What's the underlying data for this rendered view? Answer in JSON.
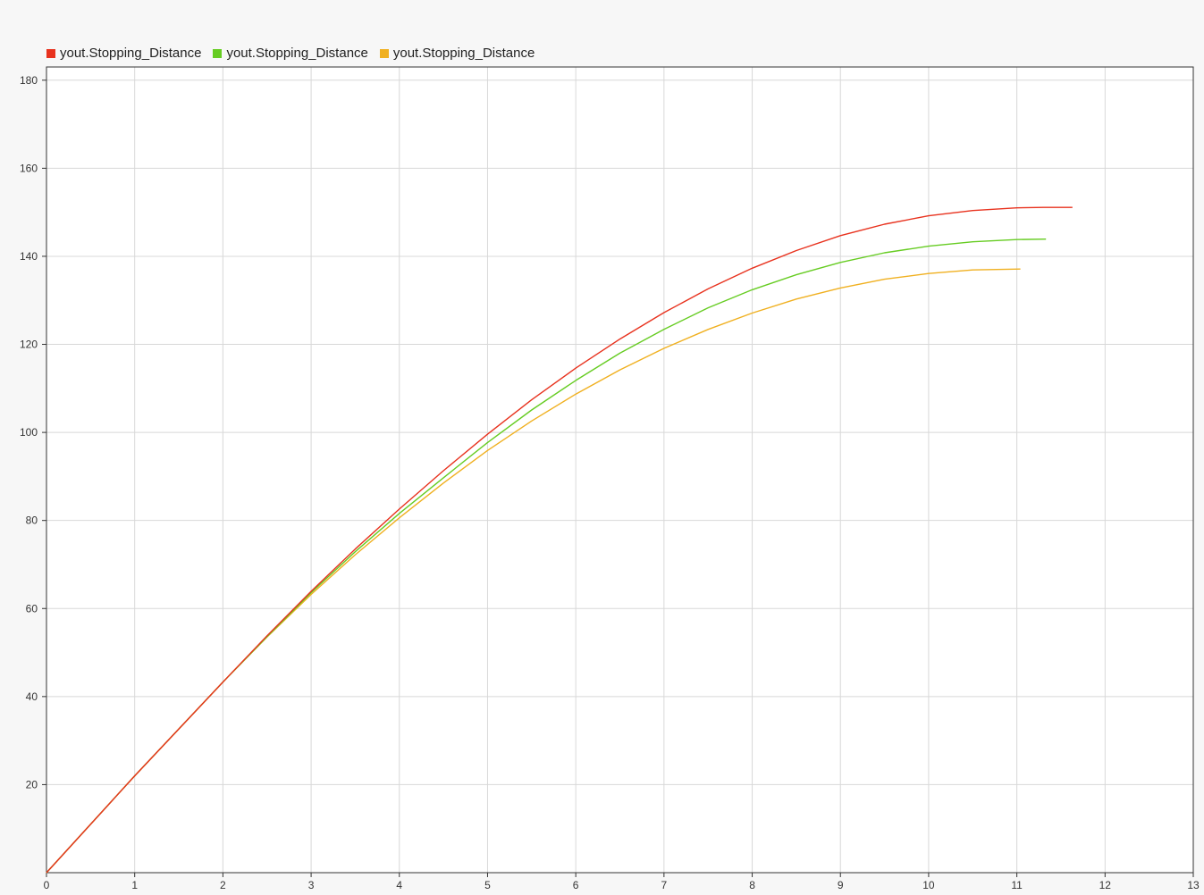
{
  "chart_data": {
    "type": "line",
    "title": "",
    "xlabel": "",
    "ylabel": "",
    "xlim": [
      0,
      13
    ],
    "ylim": [
      0,
      183
    ],
    "x_ticks": [
      0,
      1,
      2,
      3,
      4,
      5,
      6,
      7,
      8,
      9,
      10,
      11,
      12,
      13
    ],
    "y_ticks": [
      20,
      40,
      60,
      80,
      100,
      120,
      140,
      160,
      180
    ],
    "grid": true,
    "legend_position": "top-left",
    "series": [
      {
        "name": "yout.Stopping_Distance",
        "color": "#e8321e",
        "x": [
          0,
          1,
          2,
          2.5,
          3,
          3.5,
          4,
          4.5,
          5,
          5.5,
          6,
          6.5,
          7,
          7.5,
          8,
          8.5,
          9,
          9.5,
          10,
          10.5,
          11,
          11.3,
          11.63
        ],
        "y": [
          0,
          22,
          43.3,
          53.8,
          63.9,
          73.5,
          82.6,
          91.3,
          99.6,
          107.4,
          114.6,
          121.2,
          127.2,
          132.6,
          137.3,
          141.3,
          144.7,
          147.3,
          149.2,
          150.4,
          151.0,
          151.1,
          151.1
        ]
      },
      {
        "name": "yout.Stopping_Distance",
        "color": "#66cc22",
        "x": [
          0,
          1,
          2,
          2.5,
          3,
          3.5,
          4,
          4.5,
          5,
          5.5,
          6,
          6.5,
          7,
          7.5,
          8,
          8.5,
          9,
          9.5,
          10,
          10.5,
          11,
          11.33
        ],
        "y": [
          0,
          22,
          43.3,
          53.6,
          63.6,
          72.9,
          81.6,
          89.7,
          97.7,
          105.1,
          111.8,
          118.0,
          123.4,
          128.3,
          132.4,
          135.8,
          138.6,
          140.8,
          142.3,
          143.3,
          143.8,
          143.9
        ]
      },
      {
        "name": "yout.Stopping_Distance",
        "color": "#f0b020",
        "x": [
          0,
          1,
          2,
          2.5,
          3,
          3.5,
          4,
          4.5,
          5,
          5.5,
          6,
          6.5,
          7,
          7.5,
          8,
          8.5,
          9,
          9.5,
          10,
          10.5,
          11.04
        ],
        "y": [
          0,
          22,
          43.3,
          53.5,
          63.2,
          72.2,
          80.6,
          88.5,
          95.9,
          102.6,
          108.7,
          114.2,
          119.1,
          123.4,
          127.1,
          130.3,
          132.8,
          134.8,
          136.1,
          136.9,
          137.1
        ]
      }
    ]
  },
  "colors": {
    "background": "#f7f7f7",
    "plot_background": "#ffffff",
    "grid": "#d8d8d8",
    "axis": "#333333"
  }
}
